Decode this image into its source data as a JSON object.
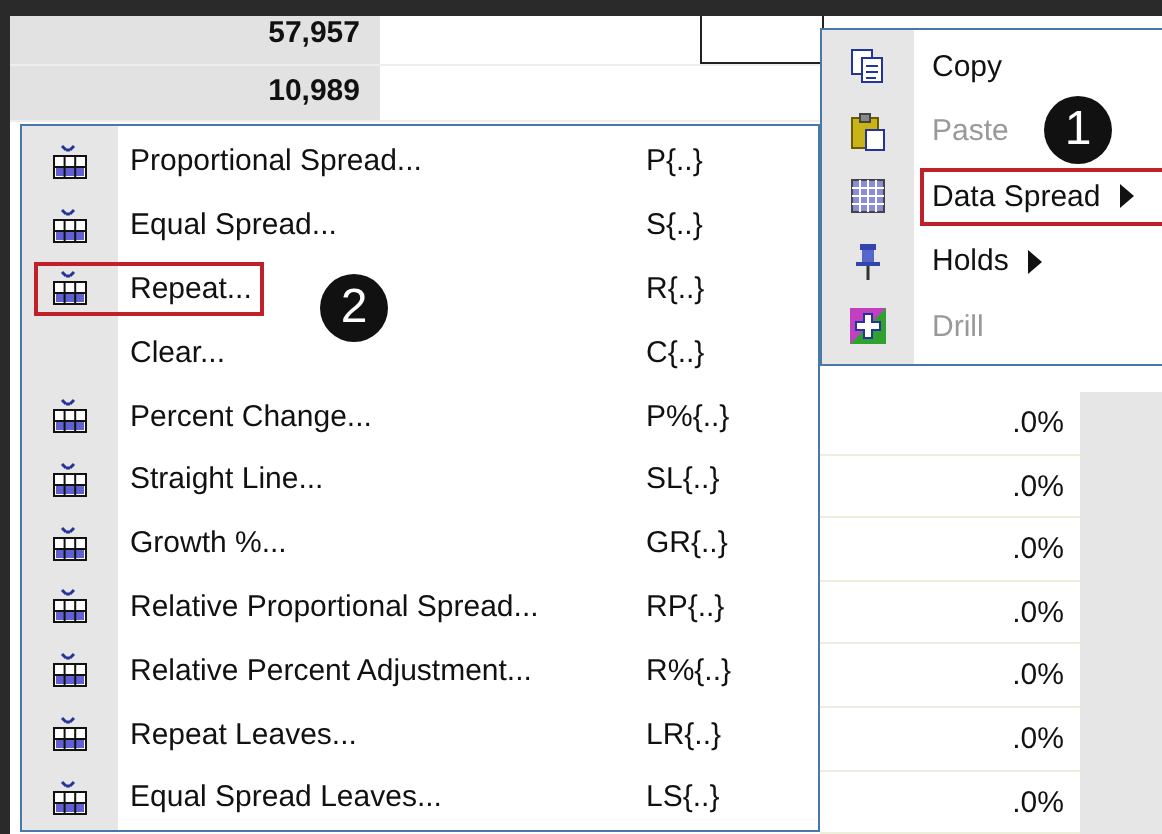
{
  "grid": {
    "amounts": [
      "57,957",
      "10,989"
    ],
    "percents": [
      ".0%",
      ".0%",
      ".0%",
      ".0%",
      ".0%",
      ".0%",
      ".0%"
    ]
  },
  "context_menu": {
    "items": [
      {
        "label": "Copy",
        "disabled": false,
        "submenu": false,
        "highlighted": false
      },
      {
        "label": "Paste",
        "disabled": true,
        "submenu": false,
        "highlighted": false
      },
      {
        "label": "Data Spread",
        "disabled": false,
        "submenu": true,
        "highlighted": true
      },
      {
        "label": "Holds",
        "disabled": false,
        "submenu": true,
        "highlighted": false
      },
      {
        "label": "Drill",
        "disabled": true,
        "submenu": false,
        "highlighted": false
      }
    ]
  },
  "submenu": {
    "items": [
      {
        "label": "Proportional Spread...",
        "shortcut": "P{..}",
        "kind": "icon",
        "highlighted": false
      },
      {
        "label": "Equal Spread...",
        "shortcut": "S{..}",
        "kind": "icon",
        "highlighted": false
      },
      {
        "label": "Repeat...",
        "shortcut": "R{..}",
        "kind": "icon",
        "highlighted": true
      },
      {
        "label": "Clear...",
        "shortcut": "C{..}",
        "kind": "text",
        "highlighted": false
      },
      {
        "label": "Percent Change...",
        "shortcut": "P%{..}",
        "kind": "icon",
        "highlighted": false
      },
      {
        "label": "Straight Line...",
        "shortcut": "SL{..}",
        "kind": "icon",
        "highlighted": false
      },
      {
        "label": "Growth %...",
        "shortcut": "GR{..}",
        "kind": "icon",
        "highlighted": false
      },
      {
        "label": "Relative Proportional Spread...",
        "shortcut": "RP{..}",
        "kind": "icon",
        "highlighted": false
      },
      {
        "label": "Relative Percent Adjustment...",
        "shortcut": "R%{..}",
        "kind": "icon",
        "highlighted": false
      },
      {
        "label": "Repeat Leaves...",
        "shortcut": "LR{..}",
        "kind": "icon",
        "highlighted": false
      },
      {
        "label": "Equal Spread Leaves...",
        "shortcut": "LS{..}",
        "kind": "icon",
        "highlighted": false
      }
    ]
  },
  "callouts": [
    "1",
    "2"
  ]
}
